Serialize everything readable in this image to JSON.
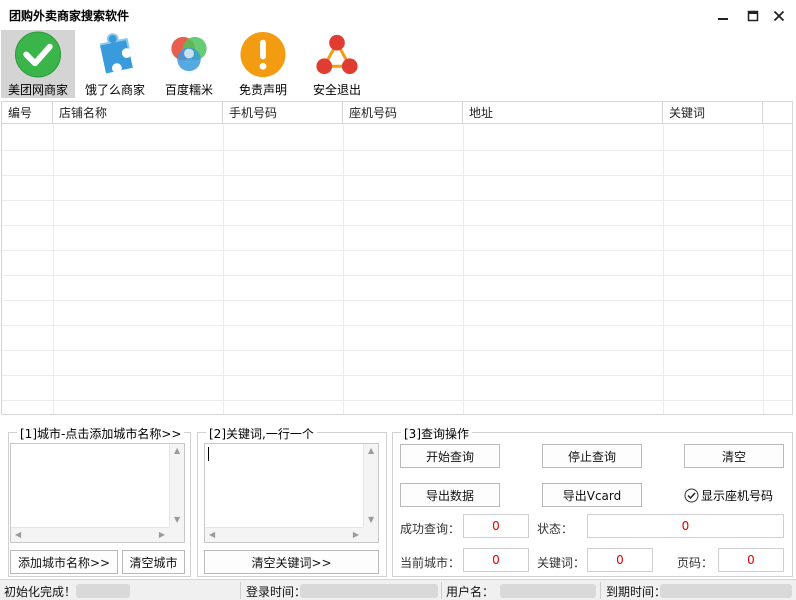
{
  "window": {
    "title": "团购外卖商家搜索软件"
  },
  "toolbar": {
    "items": [
      {
        "label": "美团网商家",
        "icon": "check-circle-icon",
        "color": "#3ab54a",
        "active": true
      },
      {
        "label": "饿了么商家",
        "icon": "puzzle-icon",
        "color": "#3a9bdc"
      },
      {
        "label": "百度糯米",
        "icon": "color-circles-icon",
        "color": "#e84c3d"
      },
      {
        "label": "免责声明",
        "icon": "exclamation-icon",
        "color": "#f39c12"
      },
      {
        "label": "安全退出",
        "icon": "network-icon",
        "color": "#e03c31"
      }
    ]
  },
  "table": {
    "columns": [
      "编号",
      "店铺名称",
      "手机号码",
      "座机号码",
      "地址",
      "关键词"
    ],
    "rows": []
  },
  "city_group": {
    "legend": "[1]城市-点击添加城市名称>>",
    "add_button": "添加城市名称>>",
    "clear_button": "清空城市"
  },
  "keyword_group": {
    "legend": "[2]关键词,一行一个",
    "clear_button": "清空关键词>>"
  },
  "query_group": {
    "legend": "[3]查询操作",
    "start_button": "开始查询",
    "stop_button": "停止查询",
    "clear_button": "清空",
    "export_button": "导出数据",
    "vcard_button": "导出Vcard",
    "show_landline_label": "显示座机号码",
    "show_landline_checked": true,
    "success_label": "成功查询：",
    "success_value": "0",
    "status_label": "状态：",
    "status_value": "0",
    "city_label": "当前城市：",
    "city_value": "0",
    "keyword_label": "关键词：",
    "keyword_value": "0",
    "page_label": "页码：",
    "page_value": "0"
  },
  "statusbar": {
    "init_text": "初始化完成！",
    "login_time_label": "登录时间：",
    "username_label": "用户名：",
    "expiry_label": "到期时间："
  },
  "colors": {
    "value_red": "#e00000",
    "active_tool_bg": "#d4d4d4"
  }
}
